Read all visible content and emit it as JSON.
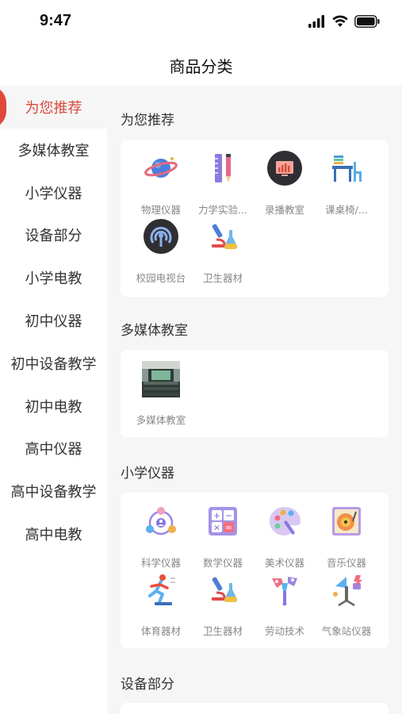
{
  "status_bar": {
    "time": "9:47"
  },
  "nav": {
    "title": "商品分类"
  },
  "sidebar": {
    "items": [
      {
        "label": "为您推荐"
      },
      {
        "label": "多媒体教室"
      },
      {
        "label": "小学仪器"
      },
      {
        "label": "设备部分"
      },
      {
        "label": "小学电教"
      },
      {
        "label": "初中仪器"
      },
      {
        "label": "初中设备教学"
      },
      {
        "label": "初中电教"
      },
      {
        "label": "高中仪器"
      },
      {
        "label": "高中设备教学"
      },
      {
        "label": "高中电教"
      }
    ]
  },
  "sections": [
    {
      "title": "为您推荐",
      "items": [
        {
          "label": "物理仪器",
          "icon": "planet-icon"
        },
        {
          "label": "力学实验...",
          "icon": "pencil-ruler-icon"
        },
        {
          "label": "录播教室",
          "icon": "recording-screen-icon"
        },
        {
          "label": "课桌椅/...",
          "icon": "desk-chair-icon"
        },
        {
          "label": "校园电视台",
          "icon": "broadcast-icon"
        },
        {
          "label": "卫生器材",
          "icon": "microscope-icon"
        }
      ]
    },
    {
      "title": "多媒体教室",
      "items": [
        {
          "label": "多媒体教室",
          "icon": "classroom-photo"
        }
      ]
    },
    {
      "title": "小学仪器",
      "items": [
        {
          "label": "科学仪器",
          "icon": "science-network-icon"
        },
        {
          "label": "数学仪器",
          "icon": "calculator-icon"
        },
        {
          "label": "美术仪器",
          "icon": "palette-icon"
        },
        {
          "label": "音乐仪器",
          "icon": "record-player-icon"
        },
        {
          "label": "体育器材",
          "icon": "runner-icon"
        },
        {
          "label": "卫生器材",
          "icon": "microscope-icon"
        },
        {
          "label": "劳动技术",
          "icon": "tools-icon"
        },
        {
          "label": "气象站仪器",
          "icon": "weather-station-icon"
        }
      ]
    },
    {
      "title": "设备部分",
      "items": []
    }
  ]
}
